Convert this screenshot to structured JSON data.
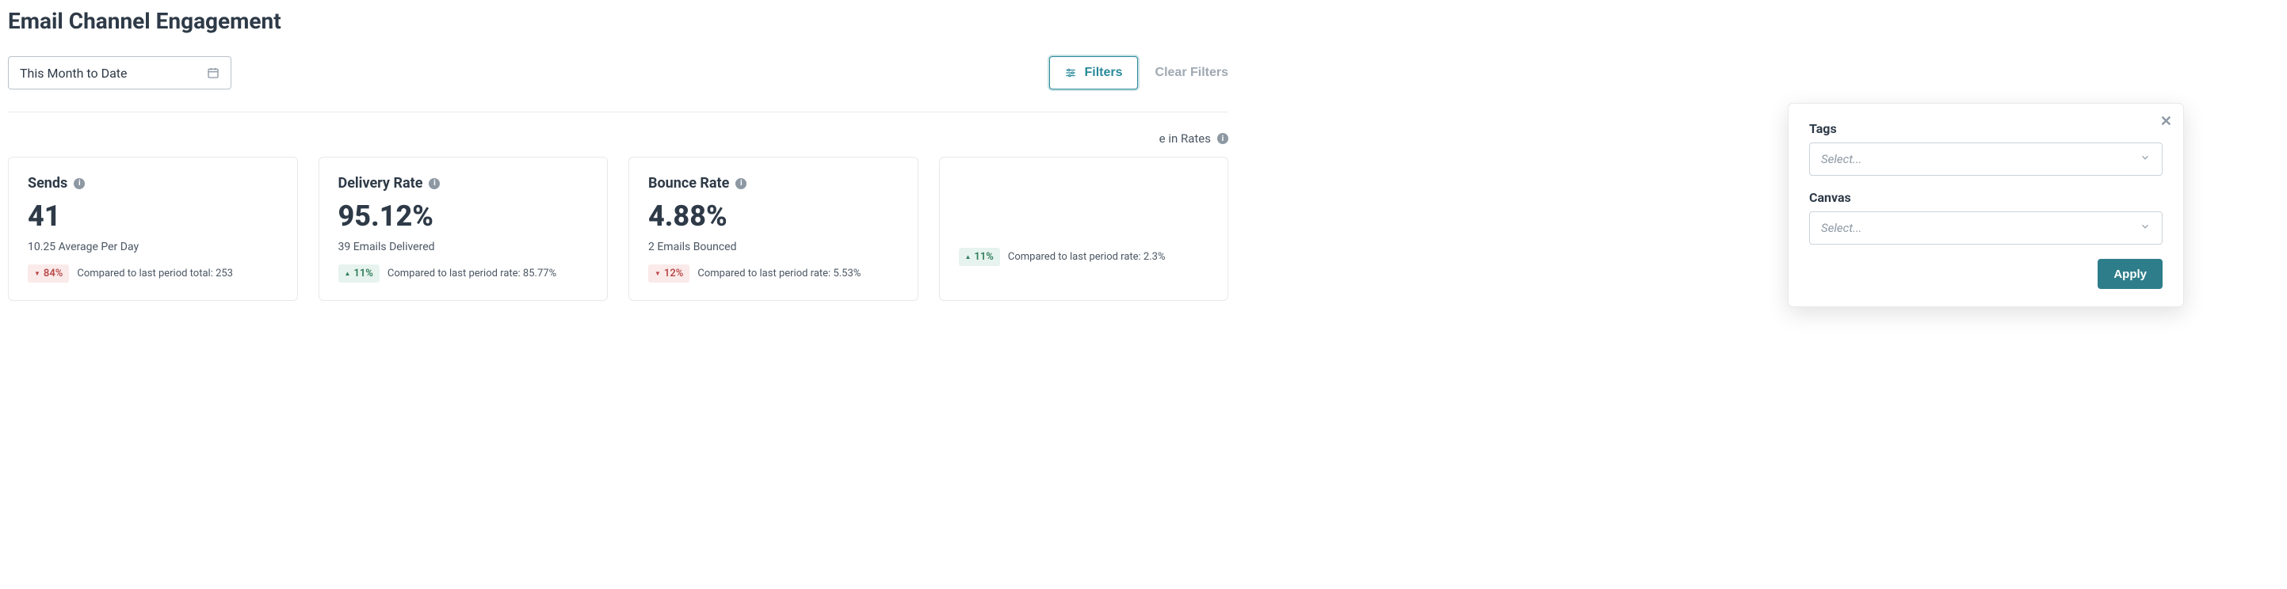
{
  "page": {
    "title": "Email Channel Engagement"
  },
  "toolbar": {
    "date_label": "This Month to Date",
    "filters_label": "Filters",
    "clear_filters_label": "Clear Filters"
  },
  "section": {
    "rates_label": "e in Rates"
  },
  "popover": {
    "tags_label": "Tags",
    "tags_placeholder": "Select...",
    "canvas_label": "Canvas",
    "canvas_placeholder": "Select...",
    "apply_label": "Apply"
  },
  "cards": [
    {
      "title": "Sends",
      "value": "41",
      "sub": "10.25 Average Per Day",
      "delta_direction": "down",
      "delta_value": "84%",
      "compare_text": "Compared to last period total: 253"
    },
    {
      "title": "Delivery Rate",
      "value": "95.12%",
      "sub": "39 Emails Delivered",
      "delta_direction": "up",
      "delta_value": "11%",
      "compare_text": "Compared to last period rate: 85.77%"
    },
    {
      "title": "Bounce Rate",
      "value": "4.88%",
      "sub": "2 Emails Bounced",
      "delta_direction": "down",
      "delta_value": "12%",
      "compare_text": "Compared to last period rate: 5.53%"
    },
    {
      "title": "",
      "value": "",
      "sub": "",
      "delta_direction": "up",
      "delta_value": "11%",
      "compare_text": "Compared to last period rate: 2.3%"
    }
  ]
}
